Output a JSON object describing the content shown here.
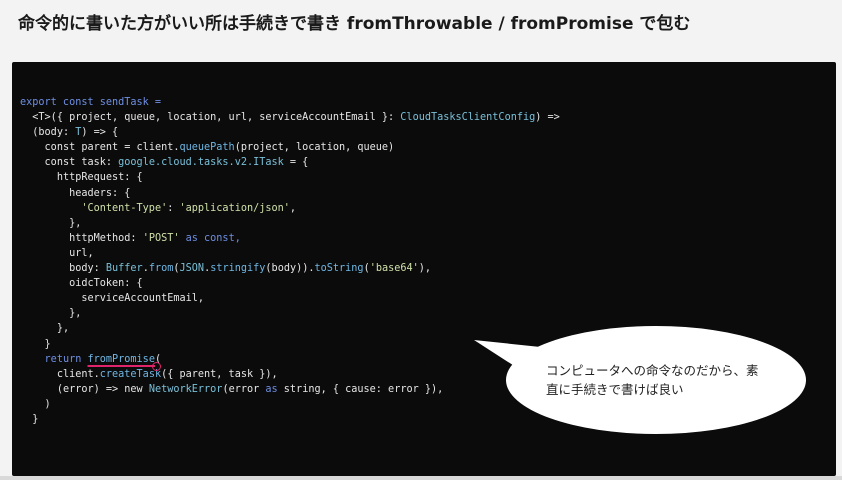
{
  "slide": {
    "title": "命令的に書いた方がいい所は手続きで書き fromThrowable / fromPromise で包む"
  },
  "code": {
    "l1": [
      "export const sendTask ="
    ],
    "l2": [
      "<T>({ project, queue, location, url, serviceAccountEmail }: ",
      "CloudTasksClientConfig",
      ") =>"
    ],
    "l3": [
      "(body: ",
      "T",
      ") => {"
    ],
    "l4": [
      "const parent = client.",
      "queuePath",
      "(project, location, queue)"
    ],
    "l5": [
      "const task: ",
      "google.cloud.tasks.v2.ITask",
      " = {"
    ],
    "l6": [
      "httpRequest: {"
    ],
    "l7": [
      "headers: {"
    ],
    "l8": [
      "'Content-Type'",
      ": ",
      "'application/json'",
      ","
    ],
    "l9": [
      "},"
    ],
    "l10": [
      "httpMethod: ",
      "'POST'",
      " as const,"
    ],
    "l11": [
      "url,"
    ],
    "l12": [
      "body: ",
      "Buffer",
      ".",
      "from",
      "(",
      "JSON",
      ".",
      "stringify",
      "(body)).",
      "toString",
      "(",
      "'base64'",
      "),"
    ],
    "l13": [
      "oidcToken: {"
    ],
    "l14": [
      "serviceAccountEmail,"
    ],
    "l15": [
      "},"
    ],
    "l16": [
      "},"
    ],
    "l17": [
      "}"
    ],
    "l18": [
      "return ",
      "fromPromise",
      "("
    ],
    "l19": [
      "client.",
      "createTask",
      "({ parent, task }),"
    ],
    "l20": [
      "(error) => new ",
      "NetworkError",
      "(error ",
      "as",
      " string, { cause: error }),"
    ],
    "l21": [
      ")"
    ],
    "l22": [
      "}"
    ]
  },
  "bubble": {
    "text": "コンピュータへの命令なのだから、素直に手続きで書けば良い"
  },
  "colors": {
    "keyword": "#6f8fe3",
    "function": "#6fb7e3",
    "string": "#cfe0a8",
    "type": "#79c0d8",
    "highlight": "#e0246b"
  }
}
